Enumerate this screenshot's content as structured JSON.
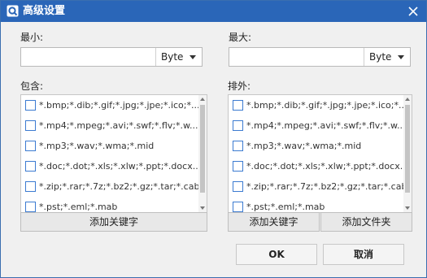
{
  "window": {
    "title": "高级设置"
  },
  "min": {
    "label": "最小:",
    "value": "",
    "unit": "Byte"
  },
  "max": {
    "label": "最大:",
    "value": "",
    "unit": "Byte"
  },
  "include": {
    "label": "包含:",
    "items": [
      "*.bmp;*.dib;*.gif;*.jpg;*.jpe;*.ico;*...",
      "*.mp4;*.mpeg;*.avi;*.swf;*.flv;*.w...",
      "*.mp3;*.wav;*.wma;*.mid",
      "*.doc;*.dot;*.xls;*.xlw;*.ppt;*.docx...",
      "*.zip;*.rar;*.7z;*.bz2;*.gz;*.tar;*.cab",
      "*.pst;*.eml;*.mab"
    ],
    "add_keyword": "添加关键字"
  },
  "exclude": {
    "label": "排外:",
    "items": [
      "*.bmp;*.dib;*.gif;*.jpg;*.jpe;*.ico;*...",
      "*.mp4;*.mpeg;*.avi;*.swf;*.flv;*.w...",
      "*.mp3;*.wav;*.wma;*.mid",
      "*.doc;*.dot;*.xls;*.xlw;*.ppt;*.docx...",
      "*.zip;*.rar;*.7z;*.bz2;*.gz;*.tar;*.cab",
      "*.pst;*.eml;*.mab"
    ],
    "add_keyword": "添加关键字",
    "add_folder": "添加文件夹"
  },
  "footer": {
    "ok": "OK",
    "cancel": "取消"
  },
  "colors": {
    "titlebar": "#2a66b8",
    "checkbox_border": "#3c7bd1"
  }
}
